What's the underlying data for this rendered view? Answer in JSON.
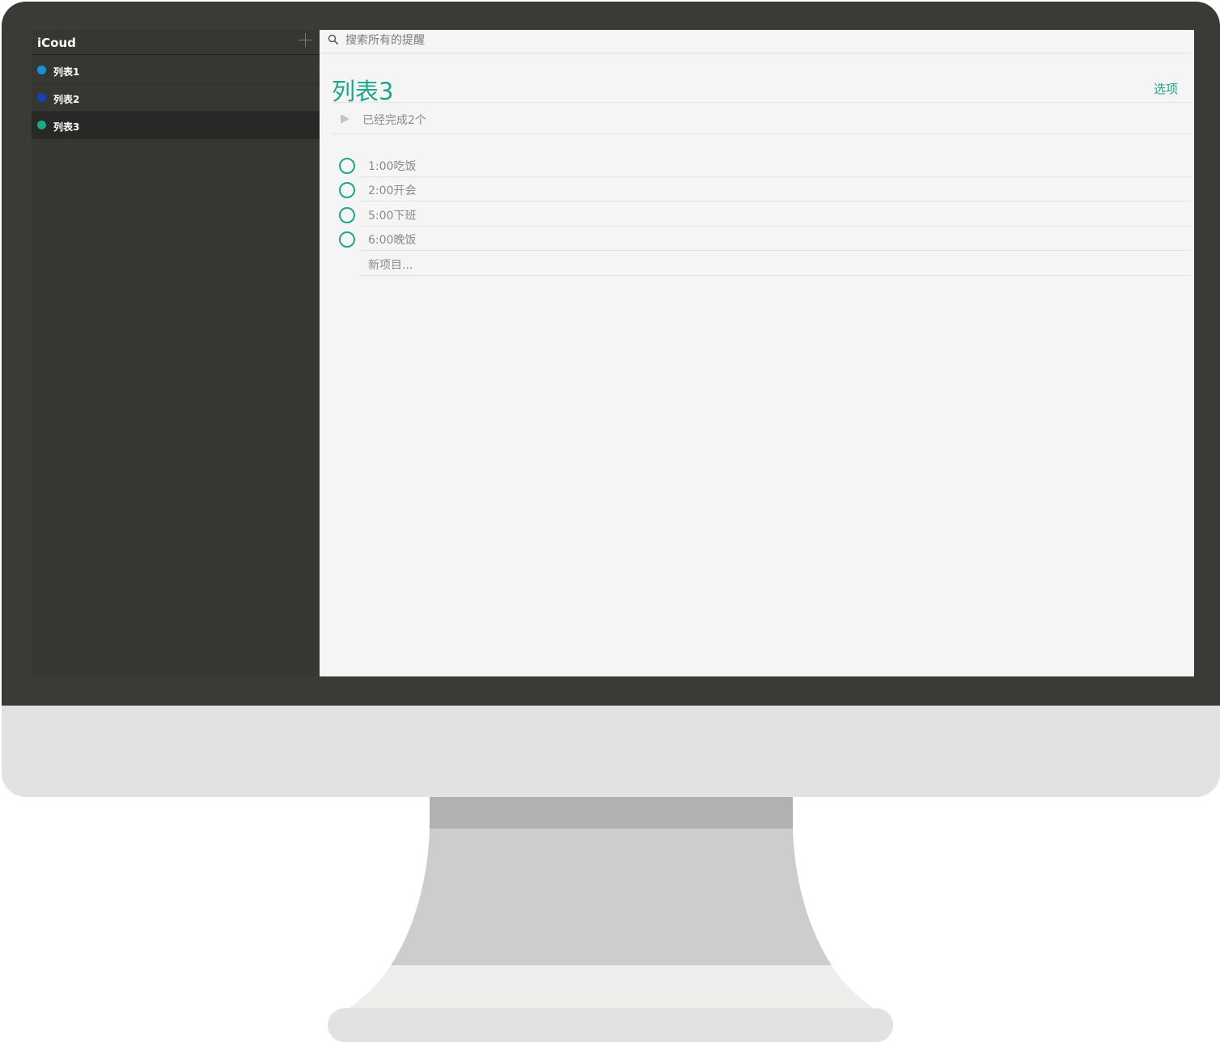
{
  "sidebar": {
    "account": "iCoud",
    "add_icon": "plus-icon",
    "lists": [
      {
        "label": "列表1",
        "color": "#1a8fd9"
      },
      {
        "label": "列表2",
        "color": "#1642b8"
      },
      {
        "label": "列表3",
        "color": "#1fa58a",
        "selected": true
      }
    ]
  },
  "search": {
    "placeholder": "搜索所有的提醒",
    "icon": "search-icon"
  },
  "main": {
    "title": "列表3",
    "options_label": "选项",
    "completed_label": "已经完成2个",
    "tasks": [
      {
        "text": "1:00吃饭"
      },
      {
        "text": "2:00开会"
      },
      {
        "text": "5:00下班"
      },
      {
        "text": "6:00晚饭"
      }
    ],
    "new_item_placeholder": "新项目..."
  },
  "colors": {
    "accent": "#1fa58a",
    "sidebar_bg": "#363633",
    "bezel": "#3a3b37",
    "content_bg": "#f5f5f5"
  }
}
